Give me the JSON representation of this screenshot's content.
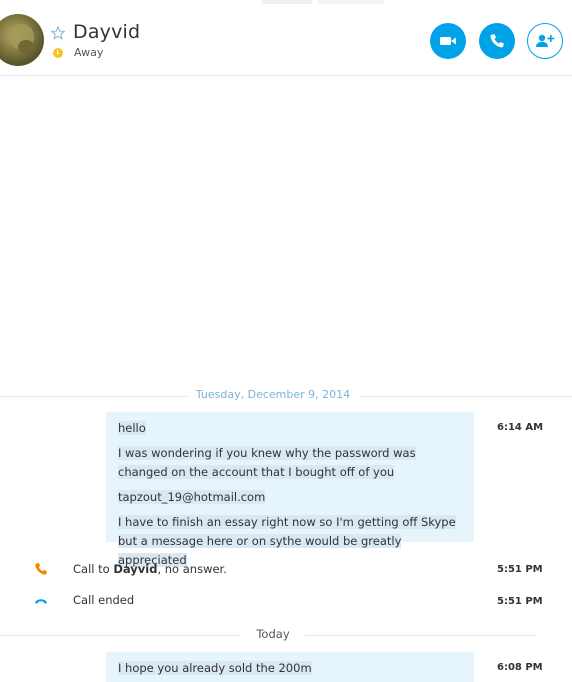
{
  "contact": {
    "name": "Dayvid",
    "status": "Away"
  },
  "header_actions": {
    "video_call": "video-camera-icon",
    "audio_call": "phone-icon",
    "add_people": "add-person-icon"
  },
  "colors": {
    "accent": "#00a2e8",
    "away": "#f8c42a",
    "missed_call": "#f08a00",
    "bubble": "#e6f4fc"
  },
  "conversation": {
    "day1": {
      "date_label": "Tuesday, December 9, 2014",
      "message": {
        "time": "6:14 AM",
        "lines": [
          "hello",
          "I was wondering if you knew why the password was changed on the account that I bought off of you",
          "tapzout_19@hotmail.com",
          "I have to finish an essay right now so I'm getting off Skype but a message here or on sythe would be greatly appreciated"
        ]
      },
      "events": [
        {
          "prefix": "Call to ",
          "name": "Dayvid",
          "suffix": ", no answer.",
          "time": "5:51 PM",
          "icon": "missed-call-icon"
        },
        {
          "text": "Call ended",
          "time": "5:51 PM",
          "icon": "call-ended-icon"
        }
      ]
    },
    "day2": {
      "date_label": "Today",
      "message": {
        "time": "6:08 PM",
        "lines": [
          "I hope you already sold the 200m"
        ]
      }
    }
  }
}
